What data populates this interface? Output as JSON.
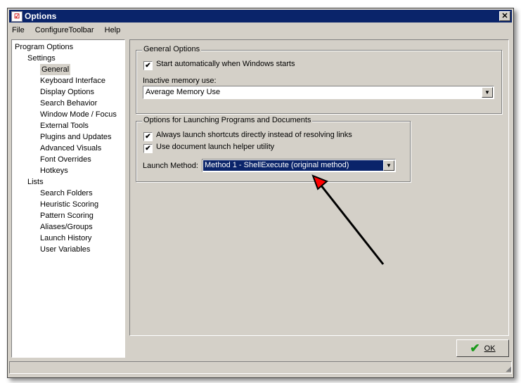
{
  "window": {
    "title": "Options",
    "close": "✕"
  },
  "menu": [
    "File",
    "ConfigureToolbar",
    "Help"
  ],
  "tree": {
    "root": "Program Options",
    "settings": "Settings",
    "settings_items": [
      "General",
      "Keyboard Interface",
      "Display Options",
      "Search Behavior",
      "Window Mode / Focus",
      "External Tools",
      "Plugins and Updates",
      "Advanced Visuals",
      "Font Overrides",
      "Hotkeys"
    ],
    "lists": "Lists",
    "lists_items": [
      "Search Folders",
      "Heuristic Scoring",
      "Pattern Scoring",
      "Aliases/Groups",
      "Launch History",
      "User Variables"
    ],
    "selected": "General"
  },
  "general": {
    "legend": "General Options",
    "start_auto": {
      "label": "Start automatically when Windows starts",
      "checked": true
    },
    "memory_label": "Inactive memory use:",
    "memory_value": "Average Memory Use"
  },
  "launching": {
    "legend": "Options for Launching Programs and Documents",
    "always_launch": {
      "label": "Always launch shortcuts directly instead of resolving links",
      "checked": true
    },
    "helper": {
      "label": "Use document launch helper utility",
      "checked": true
    },
    "method_label": "Launch Method:",
    "method_value": "Method 1 - ShellExecute (original method)"
  },
  "ok_label": "OK",
  "colors": {
    "titlebar": "#0a246a",
    "face": "#d4d0c8",
    "selection": "#0a246a",
    "arrow_head": "#ff0000"
  }
}
